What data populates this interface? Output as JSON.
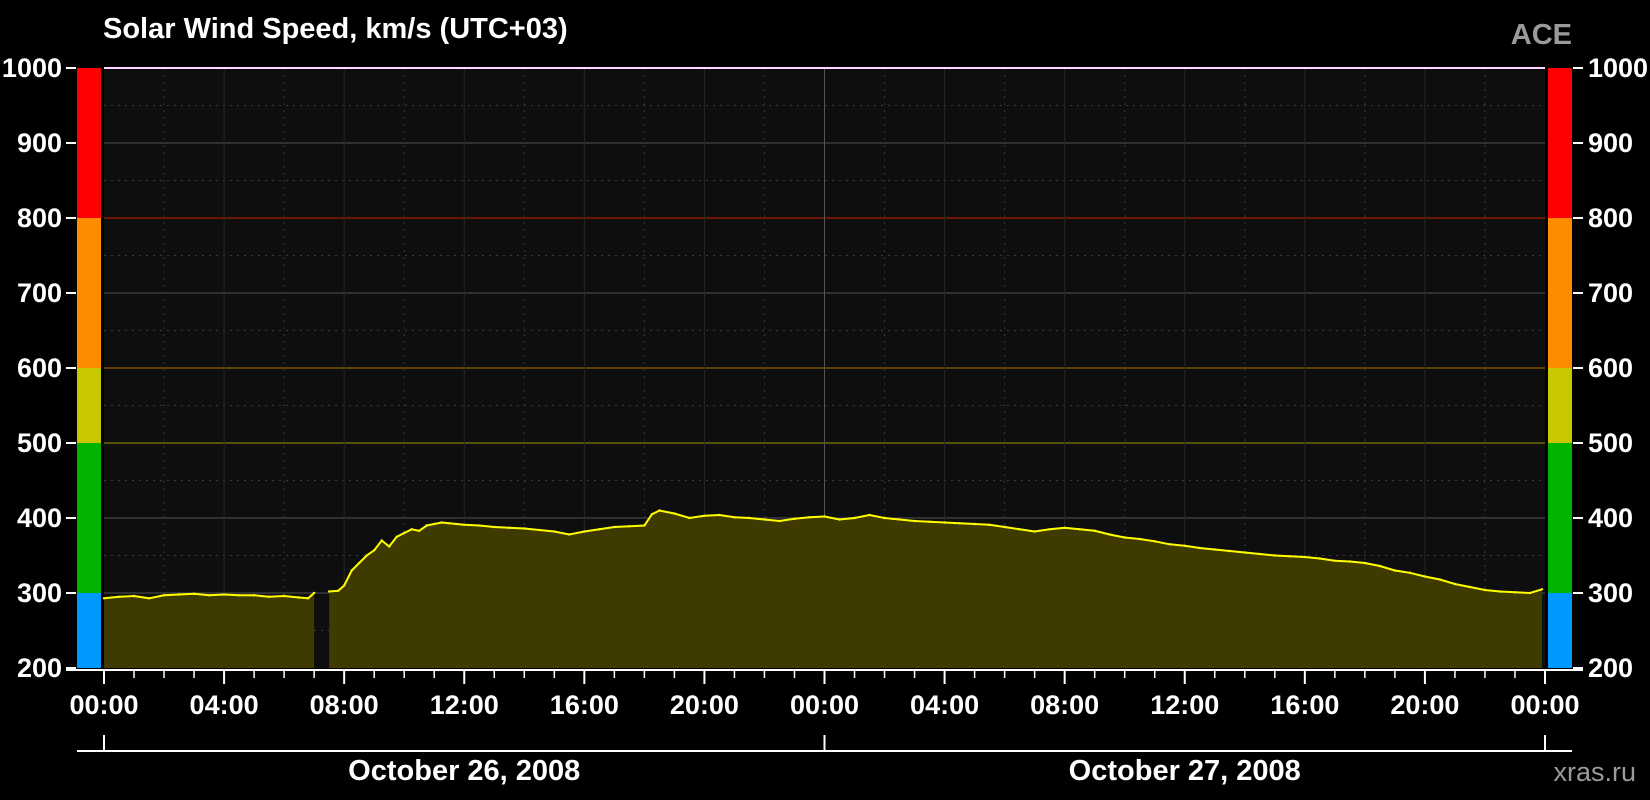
{
  "chart_data": {
    "type": "area",
    "title": "Solar Wind Speed, km/s (UTC+03)",
    "source": "ACE",
    "credit": "xras.ru",
    "ylim": [
      200,
      1000
    ],
    "yticks": [
      "200",
      "300",
      "400",
      "500",
      "600",
      "700",
      "800",
      "900",
      "1000"
    ],
    "x_range_hours": [
      0,
      48
    ],
    "xticks": [
      "00:00",
      "04:00",
      "08:00",
      "12:00",
      "16:00",
      "20:00",
      "00:00",
      "04:00",
      "08:00",
      "12:00",
      "16:00",
      "20:00",
      "00:00"
    ],
    "dates": [
      "October 26, 2008",
      "October 27, 2008"
    ],
    "levels": [
      {
        "from": 200,
        "to": 300,
        "color": "#0099ff"
      },
      {
        "from": 300,
        "to": 500,
        "color": "#00b400"
      },
      {
        "from": 500,
        "to": 600,
        "color": "#c8c800"
      },
      {
        "from": 600,
        "to": 800,
        "color": "#ff8c00"
      },
      {
        "from": 800,
        "to": 1000,
        "color": "#ff0000"
      }
    ],
    "threshold_lines": [
      {
        "value": 500,
        "color": "#6b6b00"
      },
      {
        "value": 600,
        "color": "#7a5200"
      },
      {
        "value": 800,
        "color": "#8a1a00"
      }
    ],
    "grid": true,
    "line_color": "#ffff00",
    "fill_color": "#3f3a00",
    "series": [
      {
        "hours": [
          0.0,
          0.5,
          1.0,
          1.5,
          2.0,
          2.5,
          3.0,
          3.5,
          4.0,
          4.5,
          5.0,
          5.5,
          6.0,
          6.5,
          6.8,
          7.0,
          7.5,
          7.8,
          8.0,
          8.25,
          8.5,
          8.75,
          9.0,
          9.25,
          9.5,
          9.75,
          10.0,
          10.25,
          10.5,
          10.75,
          11.0,
          11.25,
          11.5,
          12.0,
          12.5,
          13.0,
          13.5,
          14.0,
          14.5,
          15.0,
          15.5,
          16.0,
          16.5,
          17.0,
          17.5,
          18.0,
          18.25,
          18.5,
          19.0,
          19.5,
          20.0,
          20.5,
          21.0,
          21.5,
          22.0,
          22.5,
          23.0,
          23.5,
          24.0,
          24.5,
          25.0,
          25.5,
          26.0,
          26.5,
          27.0,
          27.5,
          28.0,
          28.5,
          29.0,
          29.5,
          30.0,
          30.5,
          31.0,
          31.5,
          32.0,
          32.5,
          33.0,
          33.5,
          34.0,
          34.5,
          35.0,
          35.5,
          36.0,
          36.5,
          37.0,
          37.5,
          38.0,
          38.5,
          39.0,
          39.5,
          40.0,
          40.5,
          41.0,
          41.5,
          42.0,
          42.5,
          43.0,
          43.5,
          44.0,
          44.5,
          45.0,
          45.5,
          46.0,
          46.5,
          47.0,
          47.5,
          47.9
        ],
        "values": [
          293,
          295,
          296,
          293,
          297,
          298,
          299,
          297,
          298,
          297,
          297,
          295,
          296,
          294,
          293,
          300,
          302,
          303,
          310,
          330,
          340,
          350,
          357,
          370,
          362,
          375,
          380,
          385,
          383,
          390,
          392,
          394,
          393,
          391,
          390,
          388,
          387,
          386,
          384,
          382,
          378,
          382,
          385,
          388,
          389,
          390,
          405,
          410,
          406,
          400,
          403,
          404,
          401,
          400,
          398,
          396,
          399,
          401,
          402,
          398,
          400,
          404,
          400,
          398,
          396,
          395,
          394,
          393,
          392,
          391,
          388,
          385,
          382,
          385,
          387,
          385,
          383,
          378,
          374,
          372,
          369,
          365,
          363,
          360,
          358,
          356,
          354,
          352,
          350,
          349,
          348,
          346,
          343,
          342,
          340,
          336,
          330,
          327,
          322,
          318,
          312,
          308,
          304,
          302,
          301,
          300,
          305
        ]
      }
    ]
  }
}
